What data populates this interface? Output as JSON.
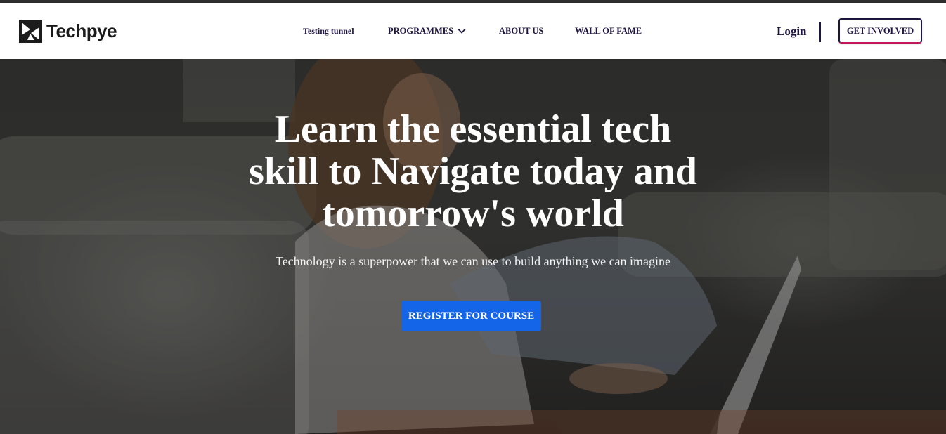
{
  "brand": {
    "name": "Techpye",
    "logo_icon": "techpye-logo-icon"
  },
  "nav": {
    "items": [
      {
        "label": "Testing tunnel"
      },
      {
        "label": "PROGRAMMES",
        "icon": "chevron-down-icon"
      },
      {
        "label": "ABOUT US"
      },
      {
        "label": "WALL OF FAME"
      }
    ],
    "login_label": "Login",
    "cta_label": "GET INVOLVED"
  },
  "hero": {
    "title_lines": [
      "Learn the essential tech",
      "skill to Navigate today and",
      "tomorrow's world"
    ],
    "subtitle": "Technology is a superpower that we can use to build anything we can imagine",
    "button_label": "REGISTER FOR COURSE",
    "image": "woman-with-laptop-photo"
  },
  "colors": {
    "nav_text": "#1e1440",
    "primary_button": "#1565e8",
    "accent_border": "#c2185b"
  }
}
